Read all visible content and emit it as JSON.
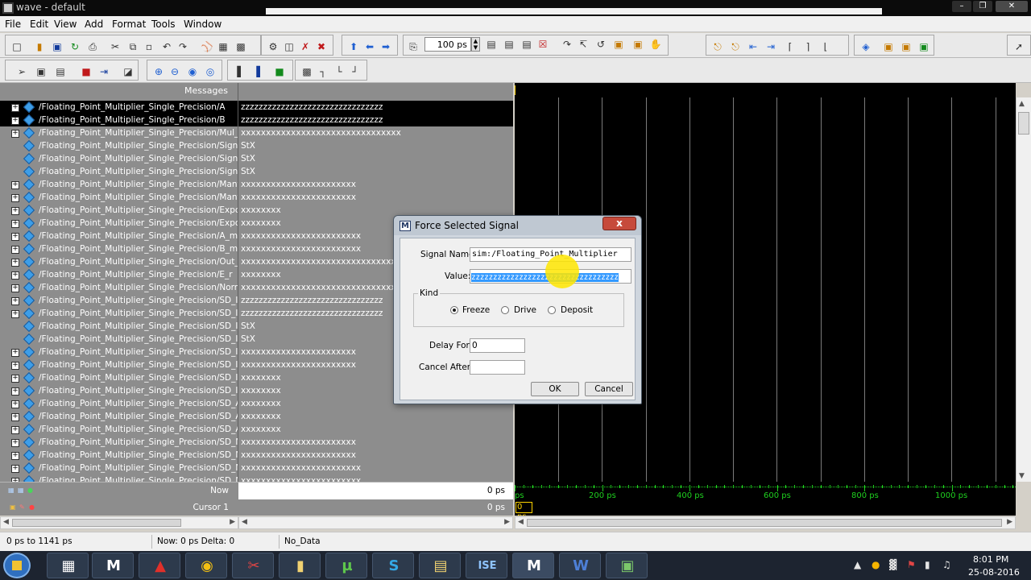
{
  "window": {
    "title": "wave - default"
  },
  "menu": [
    "File",
    "Edit",
    "View",
    "Add",
    "Format",
    "Tools",
    "Window"
  ],
  "toolbar": {
    "zoom_value": "100 ps"
  },
  "signals": {
    "header": "Messages",
    "rows": [
      {
        "name": "/Floating_Point_Multiplier_Single_Precision/A",
        "value": "zzzzzzzzzzzzzzzzzzzzzzzzzzzzzzzz",
        "expandable": true
      },
      {
        "name": "/Floating_Point_Multiplier_Single_Precision/B",
        "value": "zzzzzzzzzzzzzzzzzzzzzzzzzzzzzzzz",
        "expandable": true
      },
      {
        "name": "/Floating_Point_Multiplier_Single_Precision/Mul_Out",
        "value": "xxxxxxxxxxxxxxxxxxxxxxxxxxxxxxxx",
        "expandable": true
      },
      {
        "name": "/Floating_Point_Multiplier_Single_Precision/Sign_A",
        "value": "StX",
        "expandable": false
      },
      {
        "name": "/Floating_Point_Multiplier_Single_Precision/Sign_B",
        "value": "StX",
        "expandable": false
      },
      {
        "name": "/Floating_Point_Multiplier_Single_Precision/Sign",
        "value": "StX",
        "expandable": false
      },
      {
        "name": "/Floating_Point_Multiplier_Single_Precision/Mantissa_A",
        "value": "xxxxxxxxxxxxxxxxxxxxxxx",
        "expandable": true
      },
      {
        "name": "/Floating_Point_Multiplier_Single_Precision/Mantissa_B",
        "value": "xxxxxxxxxxxxxxxxxxxxxxx",
        "expandable": true
      },
      {
        "name": "/Floating_Point_Multiplier_Single_Precision/Exponen...",
        "value": "xxxxxxxx",
        "expandable": true
      },
      {
        "name": "/Floating_Point_Multiplier_Single_Precision/Exponen...",
        "value": "xxxxxxxx",
        "expandable": true
      },
      {
        "name": "/Floating_Point_Multiplier_Single_Precision/A_m",
        "value": "xxxxxxxxxxxxxxxxxxxxxxxx",
        "expandable": true
      },
      {
        "name": "/Floating_Point_Multiplier_Single_Precision/B_m",
        "value": "xxxxxxxxxxxxxxxxxxxxxxxx",
        "expandable": true
      },
      {
        "name": "/Floating_Point_Multiplier_Single_Precision/Out_m",
        "value": "xxxxxxxxxxxxxxxxxxxxxxxxxxxxxxxxxxxxxxxxxxxxxxxx",
        "expandable": true
      },
      {
        "name": "/Floating_Point_Multiplier_Single_Precision/E_r",
        "value": "xxxxxxxx",
        "expandable": true
      },
      {
        "name": "/Floating_Point_Multiplier_Single_Precision/Normaliz...",
        "value": "xxxxxxxxxxxxxxxxxxxxxxxxxxxxxxxxxxxxxxxxxxxxxxxx",
        "expandable": true
      },
      {
        "name": "/Floating_Point_Multiplier_Single_Precision/SD_Initia...",
        "value": "zzzzzzzzzzzzzzzzzzzzzzzzzzzzzzzz",
        "expandable": true
      },
      {
        "name": "/Floating_Point_Multiplier_Single_Precision/SD_Initia...",
        "value": "zzzzzzzzzzzzzzzzzzzzzzzzzzzzzzzz",
        "expandable": true
      },
      {
        "name": "/Floating_Point_Multiplier_Single_Precision/SD_Initia...",
        "value": "StX",
        "expandable": false
      },
      {
        "name": "/Floating_Point_Multiplier_Single_Precision/SD_Initia...",
        "value": "StX",
        "expandable": false
      },
      {
        "name": "/Floating_Point_Multiplier_Single_Precision/SD_Initia...",
        "value": "xxxxxxxxxxxxxxxxxxxxxxx",
        "expandable": true
      },
      {
        "name": "/Floating_Point_Multiplier_Single_Precision/SD_Initia...",
        "value": "xxxxxxxxxxxxxxxxxxxxxxx",
        "expandable": true
      },
      {
        "name": "/Floating_Point_Multiplier_Single_Precision/SD_Initia...",
        "value": "xxxxxxxx",
        "expandable": true
      },
      {
        "name": "/Floating_Point_Multiplier_Single_Precision/SD_Initia...",
        "value": "xxxxxxxx",
        "expandable": true
      },
      {
        "name": "/Floating_Point_Multiplier_Single_Precision/SD_Adde...",
        "value": "xxxxxxxx",
        "expandable": true
      },
      {
        "name": "/Floating_Point_Multiplier_Single_Precision/SD_Adde...",
        "value": "xxxxxxxx",
        "expandable": true
      },
      {
        "name": "/Floating_Point_Multiplier_Single_Precision/SD_Adde...",
        "value": "xxxxxxxx",
        "expandable": true
      },
      {
        "name": "/Floating_Point_Multiplier_Single_Precision/SD_Mant...",
        "value": "xxxxxxxxxxxxxxxxxxxxxxx",
        "expandable": true
      },
      {
        "name": "/Floating_Point_Multiplier_Single_Precision/SD_Mant...",
        "value": "xxxxxxxxxxxxxxxxxxxxxxx",
        "expandable": true
      },
      {
        "name": "/Floating_Point_Multiplier_Single_Precision/SD_Mant...",
        "value": "xxxxxxxxxxxxxxxxxxxxxxxx",
        "expandable": true
      },
      {
        "name": "/Floating_Point_Multiplier_Single_Precision/SD_Mant...",
        "value": "xxxxxxxxxxxxxxxxxxxxxxxx",
        "expandable": true
      }
    ]
  },
  "bottom": {
    "now_label": "Now",
    "now_value": "0 ps",
    "cursor_label": "Cursor 1",
    "cursor_value": "0 ps",
    "cursor_marker": "0 ps",
    "timeline_start": "ps",
    "timeline_labels": [
      "200 ps",
      "400 ps",
      "600 ps",
      "800 ps",
      "1000 ps"
    ]
  },
  "statusbar": {
    "range": "0 ps to 1141 ps",
    "now_delta": "Now: 0 ps  Delta: 0",
    "data": "No_Data"
  },
  "dialog": {
    "title": "Force Selected Signal",
    "close": "x",
    "signal_name_label": "Signal Name:",
    "signal_name_value": "sim:/Floating_Point_Multiplier",
    "value_label": "Value:",
    "value_value": "zzzzzzzzzzzzzzzzzzzzzzzzzzzzzzzzzz",
    "kind_label": "Kind",
    "kind_options": [
      "Freeze",
      "Drive",
      "Deposit"
    ],
    "kind_selected": "Freeze",
    "delay_label": "Delay For:",
    "delay_value": "0",
    "cancel_after_label": "Cancel After:",
    "cancel_after_value": "",
    "ok": "OK",
    "cancel": "Cancel"
  },
  "tray": {
    "time": "8:01 PM",
    "date": "25-08-2016"
  }
}
